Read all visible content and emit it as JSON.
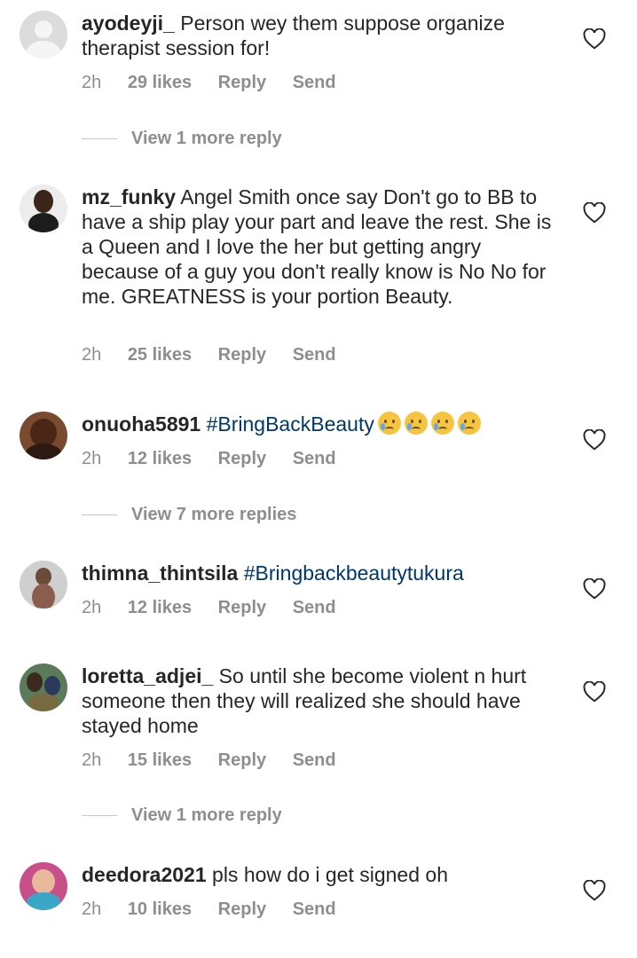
{
  "comments": [
    {
      "username": "ayodeyji_",
      "text": " Person wey them suppose organize therapist session for!",
      "time": "2h",
      "likes": "29 likes",
      "reply": "Reply",
      "send": "Send",
      "view_more": "View 1 more reply"
    },
    {
      "username": "mz_funky",
      "text": " Angel Smith once say Don't go to BB to have a ship play your part and leave the rest. She is a Queen and I love the her but getting angry because of a guy you don't really know is No No for me. GREATNESS is your portion Beauty.",
      "time": "2h",
      "likes": "25 likes",
      "reply": "Reply",
      "send": "Send"
    },
    {
      "username": "onuoha5891",
      "hashtag": "#BringBackBeauty",
      "emojis": [
        "crying-face",
        "crying-face",
        "crying-face",
        "crying-face"
      ],
      "time": "2h",
      "likes": "12 likes",
      "reply": "Reply",
      "send": "Send",
      "view_more": "View 7 more replies"
    },
    {
      "username": "thimna_thintsila",
      "hashtag": "#Bringbackbeautytukura",
      "time": "2h",
      "likes": "12 likes",
      "reply": "Reply",
      "send": "Send"
    },
    {
      "username": "loretta_adjei_",
      "text": " So until she become violent n hurt someone then they will realized she should have stayed home",
      "time": "2h",
      "likes": "15 likes",
      "reply": "Reply",
      "send": "Send",
      "view_more": "View 1 more reply"
    },
    {
      "username": "deedora2021",
      "text": " pls how do i get signed oh",
      "time": "2h",
      "likes": "10 likes",
      "reply": "Reply",
      "send": "Send"
    }
  ],
  "colors": {
    "text": "#262626",
    "muted": "#8e8e8e",
    "hashtag": "#00376b"
  },
  "icons": {
    "like": "heart-outline-icon"
  }
}
